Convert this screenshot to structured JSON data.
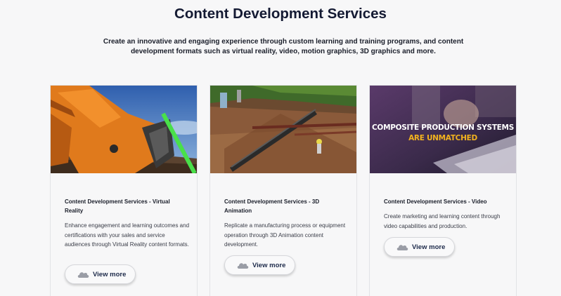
{
  "page": {
    "title": "Content Development Services",
    "intro": "Create an innovative and engaging experience through custom learning and training programs, and content development formats such as virtual reality, video, motion graphics, 3D graphics and more."
  },
  "cards": [
    {
      "title": "Content Development Services - Virtual Reality",
      "description": "Enhance engagement and learning outcomes and certifications with your sales and service audiences through Virtual Reality content formats.",
      "button": "View more",
      "image": "vr-excavator-image"
    },
    {
      "title": "Content Development Services - 3D Animation",
      "description": "Replicate a manufacturing process or equipment operation through 3D Animation content development.",
      "button": "View more",
      "image": "3d-conveyor-image"
    },
    {
      "title": "Content Development Services - Video",
      "description": "Create marketing and learning content through video capabilities and production.",
      "button": "View more",
      "image": "video-still-image",
      "image_caption_line1": "COMPOSITE PRODUCTION SYSTEMS",
      "image_caption_line2": "ARE UNMATCHED"
    }
  ],
  "colors": {
    "title": "#141a33",
    "button_text": "#1d2a4a",
    "caption_white": "#ffffff",
    "caption_gold": "#f2b21e"
  }
}
